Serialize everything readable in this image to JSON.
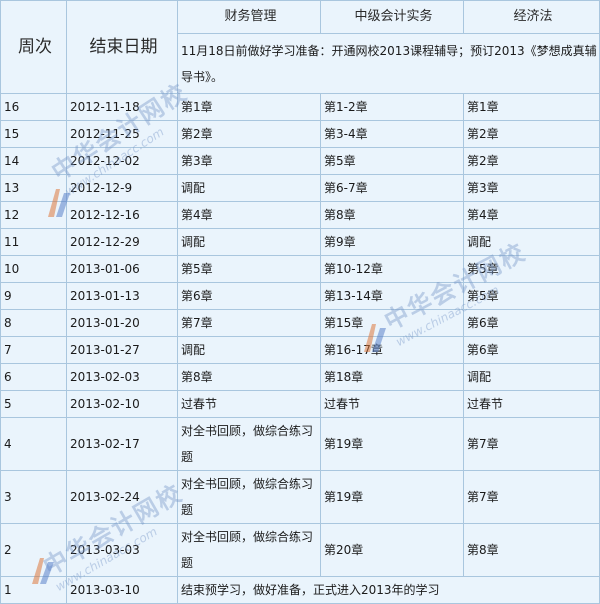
{
  "header": {
    "week": "周次",
    "end_date": "结束日期",
    "subject1": "财务管理",
    "subject2": "中级会计实务",
    "subject3": "经济法",
    "note": "11月18日前做好学习准备：开通网校2013课程辅导；预订2013《梦想成真辅导书》。"
  },
  "rows": [
    {
      "week": "16",
      "date": "2012-11-18",
      "s1": "第1章",
      "s2": "第1-2章",
      "s3": "第1章"
    },
    {
      "week": "15",
      "date": "2012-11-25",
      "s1": "第2章",
      "s2": "第3-4章",
      "s3": "第2章"
    },
    {
      "week": "14",
      "date": "2012-12-02",
      "s1": "第3章",
      "s2": "第5章",
      "s3": "第2章"
    },
    {
      "week": "13",
      "date": "2012-12-9",
      "s1": "调配",
      "s2": "第6-7章",
      "s3": "第3章"
    },
    {
      "week": "12",
      "date": "2012-12-16",
      "s1": "第4章",
      "s2": "第8章",
      "s3": "第4章"
    },
    {
      "week": "11",
      "date": "2012-12-29",
      "s1": "调配",
      "s2": "第9章",
      "s3": "调配"
    },
    {
      "week": "10",
      "date": "2013-01-06",
      "s1": "第5章",
      "s2": "第10-12章",
      "s3": "第5章"
    },
    {
      "week": "9",
      "date": "2013-01-13",
      "s1": "第6章",
      "s2": "第13-14章",
      "s3": "第5章"
    },
    {
      "week": "8",
      "date": "2013-01-20",
      "s1": "第7章",
      "s2": "第15章",
      "s3": "第6章"
    },
    {
      "week": "7",
      "date": "2013-01-27",
      "s1": "调配",
      "s2": "第16-17章",
      "s3": "第6章"
    },
    {
      "week": "6",
      "date": "2013-02-03",
      "s1": "第8章",
      "s2": "第18章",
      "s3": "调配"
    },
    {
      "week": "5",
      "date": "2013-02-10",
      "s1": "过春节",
      "s2": "过春节",
      "s3": "过春节"
    },
    {
      "week": "4",
      "date": "2013-02-17",
      "s1": "对全书回顾，做综合练习题",
      "s2": "第19章",
      "s3": "第7章"
    },
    {
      "week": "3",
      "date": "2013-02-24",
      "s1": "对全书回顾，做综合练习题",
      "s2": "第19章",
      "s3": "第7章"
    },
    {
      "week": "2",
      "date": "2013-03-03",
      "s1": "对全书回顾，做综合练习题",
      "s2": "第20章",
      "s3": "第8章"
    }
  ],
  "last_row": {
    "week": "1",
    "date": "2013-03-10",
    "text": "结束预学习，做好准备，正式进入2013年的学习"
  },
  "watermark": {
    "cn": "中华会计网校",
    "url": "www.chinaacc.com"
  },
  "colors": {
    "cell_bg": "#eaf4fc",
    "border": "#a9c6de",
    "watermark": "#7896c8"
  }
}
